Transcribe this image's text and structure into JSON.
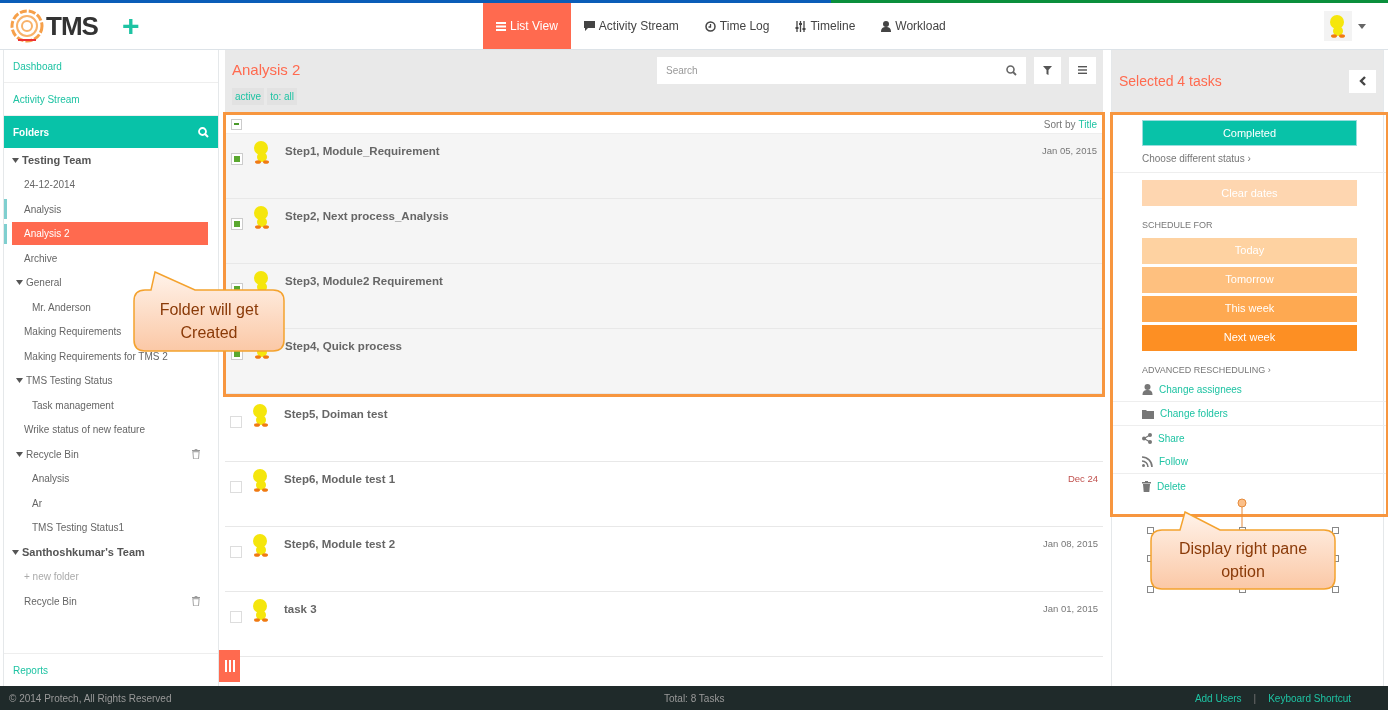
{
  "header": {
    "logo_text": "TMS",
    "add_button": "+",
    "tabs": [
      {
        "label": "List View",
        "selected": true
      },
      {
        "label": "Activity Stream",
        "selected": false
      },
      {
        "label": "Time Log",
        "selected": false
      },
      {
        "label": "Timeline",
        "selected": false
      },
      {
        "label": "Workload",
        "selected": false
      }
    ]
  },
  "sidebar": {
    "links": [
      "Dashboard",
      "Activity Stream"
    ],
    "folders_title": "Folders",
    "tree": [
      {
        "label": "Testing Team",
        "expanded": true,
        "children": [
          {
            "label": "24-12-2014",
            "marked": false,
            "selected": false
          },
          {
            "label": "Analysis",
            "marked": true,
            "selected": false
          },
          {
            "label": "Analysis 2",
            "marked": true,
            "selected": true
          },
          {
            "label": "Archive",
            "marked": false,
            "selected": false
          },
          {
            "label": "General",
            "marked": false,
            "selected": false,
            "expanded": true,
            "children": [
              {
                "label": "Mr. Anderson"
              }
            ]
          },
          {
            "label": "Making Requirements",
            "marked": false,
            "selected": false
          },
          {
            "label": "Making Requirements for TMS 2",
            "marked": false,
            "selected": false
          },
          {
            "label": "TMS Testing Status",
            "marked": false,
            "selected": false,
            "expanded": true,
            "children": [
              {
                "label": "Task management"
              }
            ]
          },
          {
            "label": "Wrike status of new feature",
            "marked": false,
            "selected": false
          },
          {
            "label": "Recycle Bin",
            "marked": false,
            "selected": false,
            "trash": true,
            "expanded": true,
            "children": [
              {
                "label": "Analysis"
              },
              {
                "label": "Ar"
              },
              {
                "label": "TMS Testing Status1"
              }
            ]
          }
        ]
      },
      {
        "label": "Santhoshkumar's Team",
        "expanded": true,
        "children": [
          {
            "label": "+ new folder",
            "kind": "new"
          },
          {
            "label": "Recycle Bin",
            "trash": true
          }
        ]
      }
    ],
    "reports": "Reports"
  },
  "main": {
    "title": "Analysis 2",
    "filters": [
      "active",
      "to: all"
    ],
    "search": {
      "placeholder": "Search"
    },
    "select_all_partial": true,
    "sort_label": "Sort by",
    "sort_value": "Title",
    "tasks": [
      {
        "title": "Step1, Module_Requirement",
        "date": "Jan 05, 2015",
        "overdue": false,
        "checked": true
      },
      {
        "title": "Step2, Next process_Analysis",
        "checked": true
      },
      {
        "title": "Step3, Module2 Requirement",
        "checked": true
      },
      {
        "title": "Step4, Quick process",
        "checked": true
      },
      {
        "title": "Step5, Doiman test",
        "checked": false
      },
      {
        "title": "Step6, Module test 1",
        "date": "Dec 24",
        "overdue": true,
        "checked": false
      },
      {
        "title": "Step6, Module test 2",
        "date": "Jan 08, 2015",
        "overdue": false,
        "checked": false
      },
      {
        "title": "task 3",
        "date": "Jan 01, 2015",
        "overdue": false,
        "checked": false
      }
    ]
  },
  "right_pane": {
    "title": "Selected 4 tasks",
    "status_button": "Completed",
    "status_link": "Choose different status ›",
    "clear_dates": "Clear dates",
    "schedule_heading": "SCHEDULE FOR",
    "schedule": [
      {
        "label": "Today",
        "color": "#fed2a1"
      },
      {
        "label": "Tomorrow",
        "color": "#fec07f"
      },
      {
        "label": "This week",
        "color": "#fea951"
      },
      {
        "label": "Next week",
        "color": "#fd8f23"
      }
    ],
    "advanced": "ADVANCED RESCHEDULING ›",
    "actions": [
      {
        "label": "Change assignees",
        "kind": "person"
      },
      {
        "label": "Change folders",
        "kind": "folder"
      },
      {
        "label": "Share",
        "kind": "share"
      },
      {
        "label": "Follow",
        "kind": "rss"
      },
      {
        "label": "Delete",
        "kind": "trash"
      }
    ]
  },
  "callouts": [
    {
      "text": "Folder will get Created"
    },
    {
      "text": "Display right pane option"
    }
  ],
  "footer": {
    "copyright": "© 2014 Protech, All Rights Reserved",
    "total": "Total: 8 Tasks",
    "links": [
      "Add Users",
      "Keyboard Shortcut"
    ],
    "separator": "|"
  }
}
